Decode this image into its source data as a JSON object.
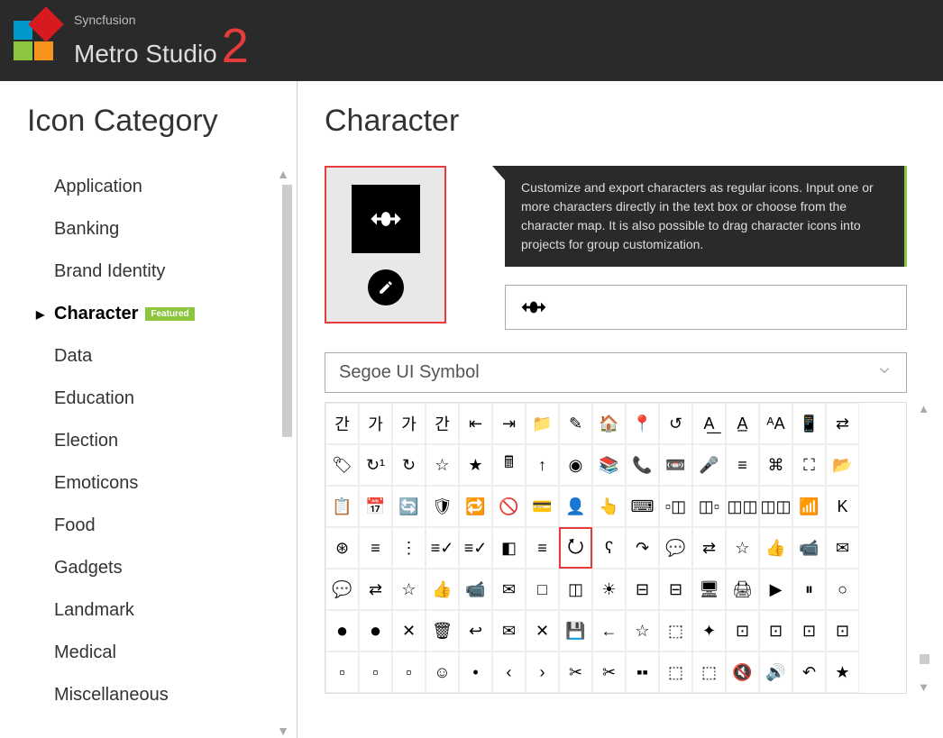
{
  "header": {
    "brand": "Syncfusion",
    "product": "Metro Studio",
    "version": "2"
  },
  "sidebar": {
    "title": "Icon Category",
    "items": [
      {
        "label": "Application",
        "active": false
      },
      {
        "label": "Banking",
        "active": false
      },
      {
        "label": "Brand Identity",
        "active": false
      },
      {
        "label": "Character",
        "active": true,
        "featured": true
      },
      {
        "label": "Data",
        "active": false
      },
      {
        "label": "Education",
        "active": false
      },
      {
        "label": "Election",
        "active": false
      },
      {
        "label": "Emoticons",
        "active": false
      },
      {
        "label": "Food",
        "active": false
      },
      {
        "label": "Gadgets",
        "active": false
      },
      {
        "label": "Landmark",
        "active": false
      },
      {
        "label": "Medical",
        "active": false
      },
      {
        "label": "Miscellaneous",
        "active": false
      }
    ]
  },
  "featured_label": "Featured",
  "content": {
    "title": "Character",
    "info_text": "Customize and export characters as regular icons. Input one or more characters directly in the text box or choose from the character map. It is also possible to drag character icons into projects for group customization.",
    "selected_char": "⭮",
    "input_value": "⭮",
    "font_name": "Segoe UI Symbol"
  },
  "char_grid": {
    "rows": [
      [
        "간",
        "가",
        "가",
        "간",
        "⇤",
        "⇥",
        "📁",
        "✎",
        "🏠",
        "📍",
        "↺",
        "A͟",
        "A̲",
        "ᴬA",
        "📱",
        "⇄"
      ],
      [
        "🏷",
        "↻¹",
        "↻",
        "☆",
        "★",
        "🖩",
        "↑",
        "◉",
        "📚",
        "📞",
        "📼",
        "🎤",
        "≡",
        "⌘",
        "⛶",
        "📂"
      ],
      [
        "📋",
        "📅",
        "🔄",
        "🛡",
        "🔁",
        "🚫",
        "💳",
        "👤",
        "👆",
        "⌨",
        "▫◫",
        "◫▫",
        "◫◫",
        "◫◫",
        "📶",
        "K"
      ],
      [
        "⊛",
        "≡",
        "⋮",
        "≡✓",
        "≡✓",
        "◧",
        "≡",
        "⭮",
        "ʕ",
        "↷",
        "💬",
        "⇄",
        "☆",
        "👍",
        "📹",
        "✉"
      ],
      [
        "💬",
        "⇄",
        "☆",
        "👍",
        "📹",
        "✉",
        "□",
        "◫",
        "☀",
        "⊟",
        "⊟",
        "🖥",
        "🖨",
        "▶",
        "⏸",
        "○"
      ],
      [
        "●",
        "●",
        "✕",
        "🗑",
        "↩",
        "✉",
        "✕",
        "💾",
        "←",
        "☆",
        "⬚",
        "✦",
        "⊡",
        "⊡",
        "⊡",
        "⊡"
      ],
      [
        "▫",
        "▫",
        "▫",
        "☺",
        "•",
        "‹",
        "›",
        "✂",
        "✂",
        "▪▪",
        "⬚",
        "⬚",
        "🔇",
        "🔊",
        "↶",
        "★"
      ]
    ],
    "selected": {
      "row": 3,
      "col": 7
    }
  }
}
